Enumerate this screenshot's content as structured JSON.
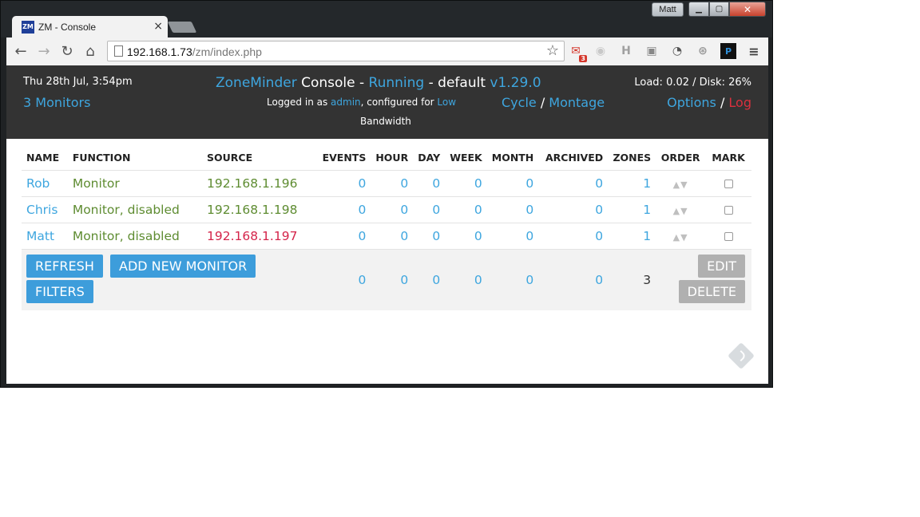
{
  "browser": {
    "user": "Matt",
    "tab": {
      "favicon": "ZM",
      "title": "ZM - Console"
    },
    "url": {
      "host": "192.168.1.73",
      "path": "/zm/index.php"
    },
    "extensions": [
      {
        "name": "gmail-icon",
        "badge": "3"
      },
      {
        "name": "camera-icon"
      },
      {
        "name": "h-icon",
        "glyph": "H"
      },
      {
        "name": "evernote-icon"
      },
      {
        "name": "speed-icon"
      },
      {
        "name": "lock-icon"
      },
      {
        "name": "bookmark-icon",
        "glyph": "P"
      },
      {
        "name": "menu-icon"
      }
    ]
  },
  "header": {
    "date": "Thu 28th Jul, 3:54pm",
    "monitors_link": "3 Monitors",
    "app_name": "ZoneMinder",
    "console": "Console",
    "dash1": " - ",
    "status": "Running",
    "dash2": " - ",
    "state": "default",
    "version": "v1.29.0",
    "logged_prefix": "Logged in as ",
    "user": "admin",
    "configured": ", configured for ",
    "bandwidth_level": "Low",
    "bandwidth_label": "Bandwidth",
    "cycle": "Cycle",
    "slash1": " / ",
    "montage": "Montage",
    "load": "Load: 0.02 / Disk: 26%",
    "options": "Options",
    "slash2": " / ",
    "log": "Log"
  },
  "table": {
    "columns": [
      "NAME",
      "FUNCTION",
      "SOURCE",
      "EVENTS",
      "HOUR",
      "DAY",
      "WEEK",
      "MONTH",
      "ARCHIVED",
      "ZONES",
      "ORDER",
      "MARK"
    ],
    "rows": [
      {
        "name": "Rob",
        "function": "Monitor",
        "source": "192.168.1.196",
        "source_status": "ok",
        "events": "0",
        "hour": "0",
        "day": "0",
        "week": "0",
        "month": "0",
        "archived": "0",
        "zones": "1"
      },
      {
        "name": "Chris",
        "function": "Monitor, disabled",
        "source": "192.168.1.198",
        "source_status": "ok",
        "events": "0",
        "hour": "0",
        "day": "0",
        "week": "0",
        "month": "0",
        "archived": "0",
        "zones": "1"
      },
      {
        "name": "Matt",
        "function": "Monitor, disabled",
        "source": "192.168.1.197",
        "source_status": "error",
        "events": "0",
        "hour": "0",
        "day": "0",
        "week": "0",
        "month": "0",
        "archived": "0",
        "zones": "1"
      }
    ],
    "order_glyph": "▲▼",
    "totals": {
      "events": "0",
      "hour": "0",
      "day": "0",
      "week": "0",
      "month": "0",
      "archived": "0",
      "zones": "3"
    },
    "buttons": {
      "refresh": "REFRESH",
      "add": "ADD NEW MONITOR",
      "filters": "FILTERS",
      "edit": "EDIT",
      "delete": "DELETE"
    }
  },
  "colors": {
    "link": "#3ea6df",
    "function": "#5e8c31",
    "source_error": "#d4244a",
    "header_bg": "#333333",
    "log": "#d9303e",
    "button": "#3d9ddb"
  }
}
